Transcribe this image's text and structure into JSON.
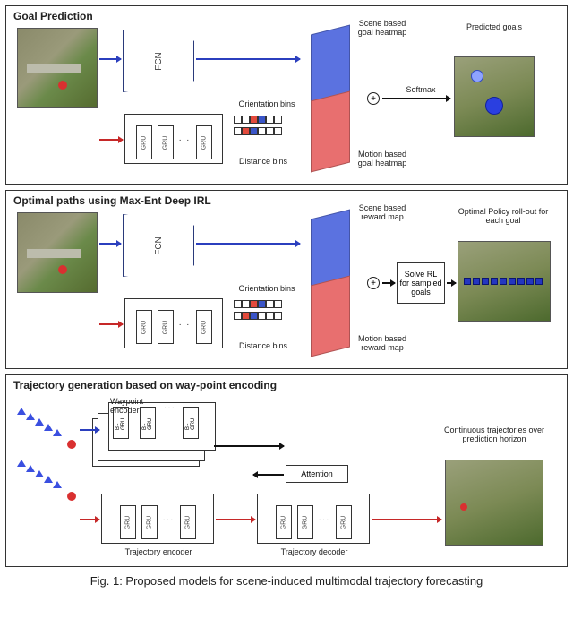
{
  "panels": {
    "goal": {
      "title": "Goal Prediction",
      "fcn": "FCN",
      "gru": "GRU",
      "orientation_bins": "Orientation bins",
      "distance_bins": "Distance bins",
      "scene_heatmap": "Scene based goal heatmap",
      "motion_heatmap": "Motion based goal heatmap",
      "softmax": "Softmax",
      "predicted_goals": "Predicted goals"
    },
    "irl": {
      "title": "Optimal paths using Max-Ent Deep IRL",
      "fcn": "FCN",
      "gru": "GRU",
      "orientation_bins": "Orientation bins",
      "distance_bins": "Distance bins",
      "scene_reward": "Scene based reward map",
      "motion_reward": "Motion based reward map",
      "solve_rl": "Solve RL for sampled goals",
      "policy_rollout": "Optimal Policy roll-out for each goal"
    },
    "traj": {
      "title": "Trajectory generation based on way-point encoding",
      "waypoint_encoder": "Waypoint encoder",
      "trajectory_encoder": "Trajectory encoder",
      "trajectory_decoder": "Trajectory decoder",
      "attention": "Attention",
      "gru": "GRU",
      "bigru": "Bi-GRU",
      "cont_traj": "Continuous trajectories over prediction horizon"
    }
  },
  "caption": "Fig. 1: Proposed models for scene-induced multimodal trajectory forecasting"
}
